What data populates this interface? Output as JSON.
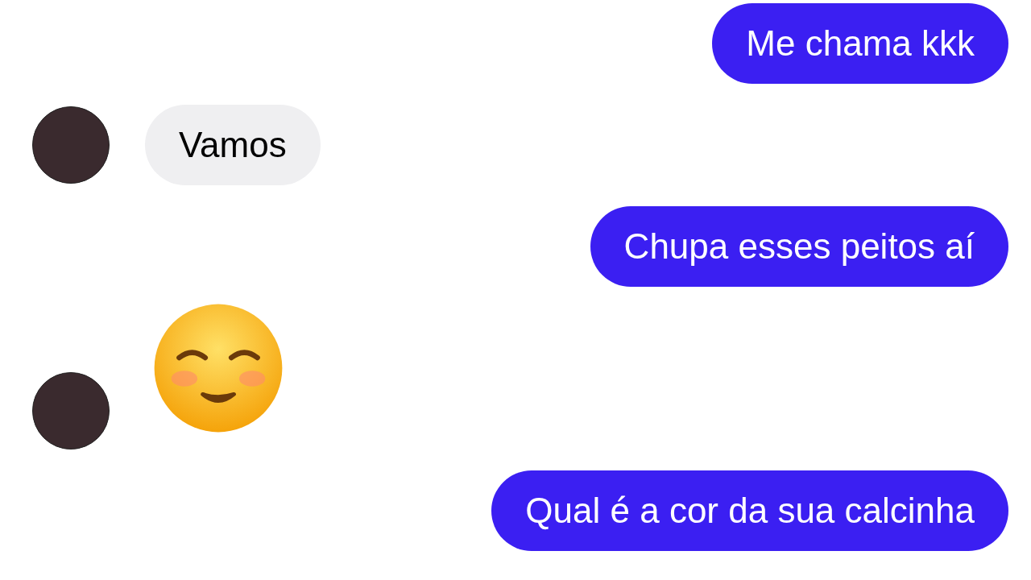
{
  "messages": [
    {
      "kind": "outgoing",
      "text": "Me chama kkk"
    },
    {
      "kind": "incoming",
      "text": "Vamos",
      "avatar": true
    },
    {
      "kind": "outgoing",
      "text": "Chupa esses peitos aí"
    },
    {
      "kind": "emoji",
      "avatar": true
    },
    {
      "kind": "outgoing",
      "text": "Qual é a cor da sua calcinha"
    }
  ]
}
